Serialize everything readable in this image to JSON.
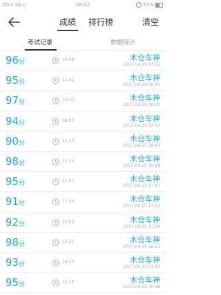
{
  "status_bar": {
    "left": "2G.ıl 4G.ıl",
    "time": "08:02",
    "battery": "55%"
  },
  "header": {
    "tabs": [
      "成绩",
      "排行榜"
    ],
    "clear_label": "清空"
  },
  "subtabs": [
    "考试记录",
    "数据统计"
  ],
  "unit": "分",
  "records": [
    {
      "score": "96",
      "duration": "10:08",
      "name": "木仓车神",
      "date": "2017.04.26",
      "time": "07:51"
    },
    {
      "score": "95",
      "duration": "11:31",
      "name": "木仓车神",
      "date": "2017.04.26",
      "time": "06:47"
    },
    {
      "score": "97",
      "duration": "10:37",
      "name": "木仓车神",
      "date": "2017.04.26",
      "time": "06:35"
    },
    {
      "score": "94",
      "duration": "09:57",
      "name": "木仓车神",
      "date": "2017.04.25",
      "time": "22:10"
    },
    {
      "score": "90",
      "duration": "11:43",
      "name": "木仓车神",
      "date": "2017.04.25",
      "time": "19:43"
    },
    {
      "score": "98",
      "duration": "11:31",
      "name": "木仓车神",
      "date": "2017.04.25",
      "time": "19:28"
    },
    {
      "score": "95",
      "duration": "11:02",
      "name": "木仓车神",
      "date": "2017.04.25",
      "time": "17:47"
    },
    {
      "score": "91",
      "duration": "11:04",
      "name": "木仓车神",
      "date": "2017.04.25",
      "time": "17:22"
    },
    {
      "score": "92",
      "duration": "13:03",
      "name": "木仓车神",
      "date": "2017.04.25",
      "time": "17:06"
    },
    {
      "score": "98",
      "duration": "12:21",
      "name": "木仓车神",
      "date": "2017.04.25",
      "time": "16:53"
    },
    {
      "score": "93",
      "duration": "14:37",
      "name": "木仓车神",
      "date": "2017.04.25",
      "time": "01:05"
    },
    {
      "score": "95",
      "duration": "12:18",
      "name": "木仓车神",
      "date": "2017.04.25",
      "time": "00:48"
    }
  ],
  "colors": {
    "accent": "#22a9c9",
    "muted": "#aaaaaa",
    "text": "#333333"
  },
  "icons": {
    "back": "arrow-left-icon",
    "clock": "clock-icon"
  }
}
